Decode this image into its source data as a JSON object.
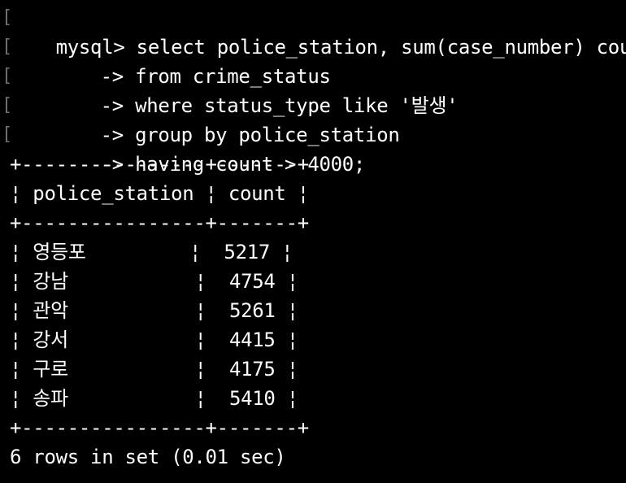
{
  "terminal": {
    "prompt": "mysql>",
    "continuation": "->",
    "gutter_marker": "[",
    "query_lines": [
      "select police_station, sum(case_number) count",
      "from crime_status",
      "where status_type like '발생'",
      "group by police_station",
      "having count > 4000;"
    ],
    "table": {
      "border": "+----------------+-------+",
      "header": "¦ police_station ¦ count ¦",
      "rows": [
        "¦ 영등포         ¦  5217 ¦",
        "¦ 강남           ¦  4754 ¦",
        "¦ 관악           ¦  5261 ¦",
        "¦ 강서           ¦  4415 ¦",
        "¦ 구로           ¦  4175 ¦",
        "¦ 송파           ¦  5410 ¦"
      ]
    },
    "result_status": "6 rows in set (0.01 sec)"
  }
}
